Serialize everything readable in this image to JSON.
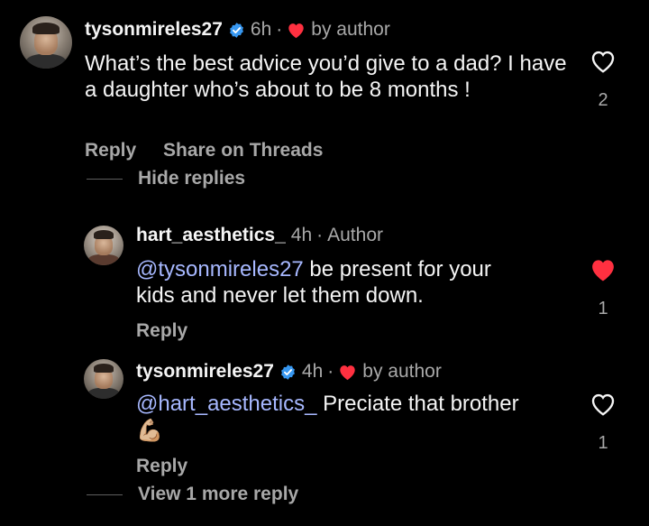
{
  "comments": [
    {
      "username": "tysonmireles27",
      "time": "6h",
      "separator": "·",
      "liked_by": "by author",
      "text": "What’s the best advice you’d give to a dad? I have a daughter who’s about to be 8 months !",
      "likes": "2",
      "reply_label": "Reply",
      "share_label": "Share on Threads",
      "toggle_replies": "Hide replies"
    },
    {
      "username": "hart_aesthetics_",
      "time": "4h",
      "separator": "·",
      "author_tag": "Author",
      "mention": "@tysonmireles27",
      "text_line1": " be present for your",
      "text_line2": "kids and never let them down.",
      "likes": "1",
      "reply_label": "Reply"
    },
    {
      "username": "tysonmireles27",
      "time": "4h",
      "separator": "·",
      "liked_by": "by author",
      "mention": "@hart_aesthetics_",
      "text": " Preciate that brother",
      "emoji": "💪🏼",
      "likes": "1",
      "reply_label": "Reply",
      "more_replies": "View 1 more reply"
    }
  ],
  "colors": {
    "background": "#000000",
    "text": "#f5f5f5",
    "secondary": "#a8a8a8",
    "mention": "#a7b8ff",
    "heart_red": "#ff3040",
    "verified_blue": "#3797f0"
  },
  "icons": {
    "verified": "verified-badge-icon",
    "author_like": "heart-filled-icon",
    "like_outline": "heart-outline-icon",
    "like_filled": "heart-filled-icon"
  }
}
